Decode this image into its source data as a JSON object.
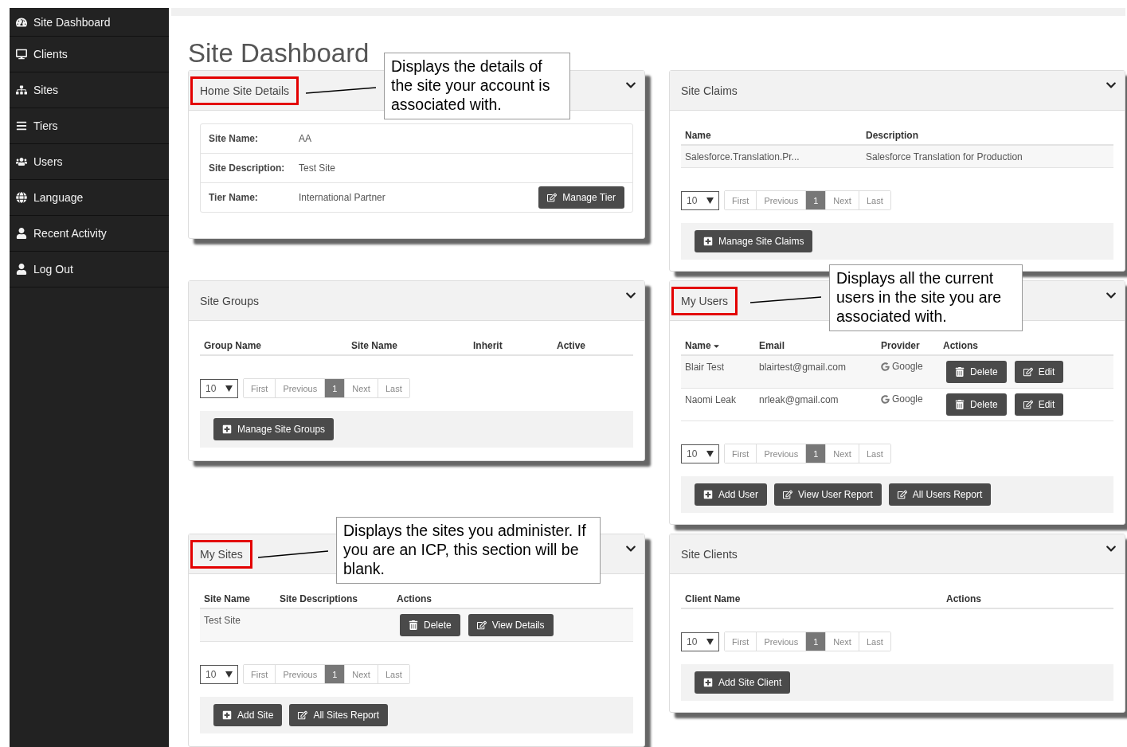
{
  "sidebar": {
    "items": [
      {
        "label": "Site Dashboard",
        "kind": "dashboard"
      },
      {
        "label": "Clients",
        "kind": "desktop"
      },
      {
        "label": "Sites",
        "kind": "sitemap"
      },
      {
        "label": "Tiers",
        "kind": "list"
      },
      {
        "label": "Users",
        "kind": "users"
      },
      {
        "label": "Language",
        "kind": "language"
      },
      {
        "label": "Recent Activity",
        "kind": "user"
      },
      {
        "label": "Log Out",
        "kind": "user"
      }
    ]
  },
  "page_title": "Site Dashboard",
  "columns": [
    {
      "panels": [
        {
          "kind": "details",
          "title": "Home Site Details",
          "highlighted": true,
          "callout": "Displays the details of the site your account is associated with.",
          "rows": [
            {
              "label": "Site Name:",
              "value": "AA"
            },
            {
              "label": "Site Description:",
              "value": "Test Site"
            },
            {
              "label": "Tier Name:",
              "value": "International Partner",
              "button": {
                "label": "Manage Tier",
                "kind": "edit"
              }
            }
          ]
        },
        {
          "kind": "table",
          "title": "Site Groups",
          "highlighted": false,
          "columns": [
            {
              "label": "Group Name",
              "sorted": false
            },
            {
              "label": "Site Name",
              "sorted": false
            },
            {
              "label": "Inherit",
              "sorted": false
            },
            {
              "label": "Active",
              "sorted": false
            }
          ],
          "pager": {
            "page_size": "10",
            "buttons": [
              {
                "label": "First",
                "selected": false
              },
              {
                "label": "Previous",
                "selected": false
              },
              {
                "label": "1",
                "selected": true
              },
              {
                "label": "Next",
                "selected": false
              },
              {
                "label": "Last",
                "selected": false
              }
            ]
          },
          "buttons": [
            {
              "label": "Manage Site Groups",
              "kind": "add"
            }
          ]
        },
        {
          "kind": "table",
          "title": "My Sites",
          "highlighted": true,
          "callout": "Displays the sites you administer. If you are an ICP, this section will be blank.",
          "columns": [
            {
              "label": "Site Name",
              "sorted": false
            },
            {
              "label": "Site Descriptions",
              "sorted": false
            },
            {
              "label": "Actions",
              "sorted": false
            }
          ],
          "rows": [
            {
              "cells": [
                {
                  "kind": "text",
                  "text": "Test Site"
                },
                {
                  "kind": "empty"
                },
                {
                  "kind": "actions",
                  "buttons": [
                    {
                      "label": "Delete",
                      "kind": "delete"
                    },
                    {
                      "label": "View Details",
                      "kind": "edit"
                    }
                  ]
                }
              ]
            }
          ],
          "pager": {
            "page_size": "10",
            "buttons": [
              {
                "label": "First",
                "selected": false
              },
              {
                "label": "Previous",
                "selected": false
              },
              {
                "label": "1",
                "selected": true
              },
              {
                "label": "Next",
                "selected": false
              },
              {
                "label": "Last",
                "selected": false
              }
            ]
          },
          "buttons": [
            {
              "label": "Add Site",
              "kind": "add"
            },
            {
              "label": "All Sites Report",
              "kind": "edit"
            }
          ]
        }
      ]
    },
    {
      "panels": [
        {
          "kind": "table",
          "title": "Site Claims",
          "highlighted": false,
          "columns": [
            {
              "label": "Name",
              "sorted": false
            },
            {
              "label": "Description",
              "sorted": false
            }
          ],
          "rows": [
            {
              "cells": [
                {
                  "kind": "text",
                  "text": "Salesforce.Translation.Pr..."
                },
                {
                  "kind": "text",
                  "text": "Salesforce Translation for Production"
                }
              ]
            }
          ],
          "pager": {
            "page_size": "10",
            "buttons": [
              {
                "label": "First",
                "selected": false
              },
              {
                "label": "Previous",
                "selected": false
              },
              {
                "label": "1",
                "selected": true
              },
              {
                "label": "Next",
                "selected": false
              },
              {
                "label": "Last",
                "selected": false
              }
            ]
          },
          "buttons": [
            {
              "label": "Manage Site Claims",
              "kind": "add"
            }
          ]
        },
        {
          "kind": "table",
          "title": "My Users",
          "highlighted": true,
          "callout": "Displays all the current users in the site you are associated with.",
          "columns": [
            {
              "label": "Name",
              "sorted": true
            },
            {
              "label": "Email",
              "sorted": false
            },
            {
              "label": "Provider",
              "sorted": false
            },
            {
              "label": "Actions",
              "sorted": false
            }
          ],
          "rows": [
            {
              "cells": [
                {
                  "kind": "text",
                  "text": "Blair Test"
                },
                {
                  "kind": "text",
                  "text": "blairtest@gmail.com"
                },
                {
                  "kind": "provider",
                  "text": "Google"
                },
                {
                  "kind": "actions",
                  "buttons": [
                    {
                      "label": "Delete",
                      "kind": "delete"
                    },
                    {
                      "label": "Edit",
                      "kind": "edit"
                    }
                  ]
                }
              ]
            },
            {
              "cells": [
                {
                  "kind": "text",
                  "text": "Naomi Leak"
                },
                {
                  "kind": "text",
                  "text": "nrleak@gmail.com"
                },
                {
                  "kind": "provider",
                  "text": "Google"
                },
                {
                  "kind": "actions",
                  "buttons": [
                    {
                      "label": "Delete",
                      "kind": "delete"
                    },
                    {
                      "label": "Edit",
                      "kind": "edit"
                    }
                  ]
                }
              ]
            }
          ],
          "pager": {
            "page_size": "10",
            "buttons": [
              {
                "label": "First",
                "selected": false
              },
              {
                "label": "Previous",
                "selected": false
              },
              {
                "label": "1",
                "selected": true
              },
              {
                "label": "Next",
                "selected": false
              },
              {
                "label": "Last",
                "selected": false
              }
            ]
          },
          "buttons": [
            {
              "label": "Add User",
              "kind": "add"
            },
            {
              "label": "View User Report",
              "kind": "edit"
            },
            {
              "label": "All Users Report",
              "kind": "edit"
            }
          ]
        },
        {
          "kind": "table",
          "title": "Site Clients",
          "highlighted": false,
          "columns": [
            {
              "label": "Client Name",
              "sorted": false
            },
            {
              "label": "Actions",
              "sorted": false
            }
          ],
          "pager": {
            "page_size": "10",
            "buttons": [
              {
                "label": "First",
                "selected": false
              },
              {
                "label": "Previous",
                "selected": false
              },
              {
                "label": "1",
                "selected": true
              },
              {
                "label": "Next",
                "selected": false
              },
              {
                "label": "Last",
                "selected": false
              }
            ]
          },
          "buttons": [
            {
              "label": "Add Site Client",
              "kind": "add"
            }
          ]
        }
      ]
    }
  ]
}
